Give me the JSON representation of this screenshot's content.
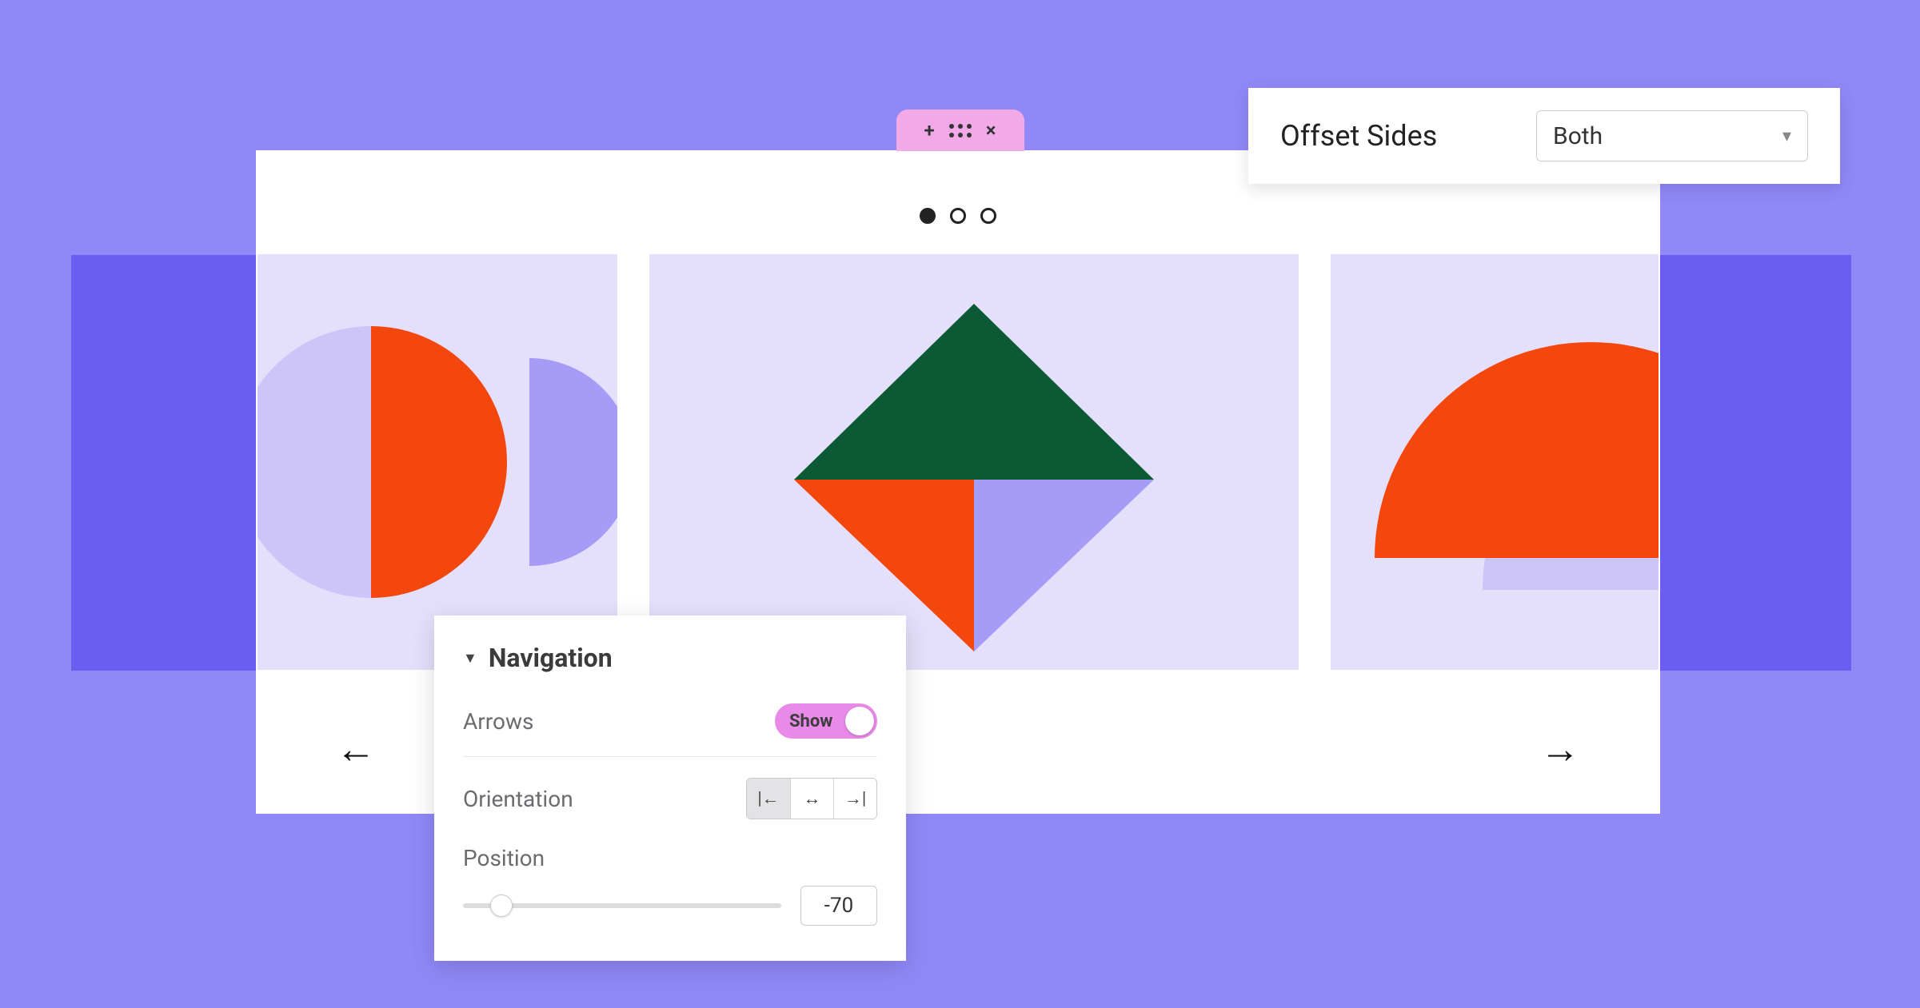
{
  "colors": {
    "bg": "#9088f7",
    "bgStripe": "#6b5cf2",
    "slide": "#e4e0fb",
    "orange": "#f3470e",
    "green": "#0b5a35",
    "lilac": "#a79bf8",
    "lightLilac": "#cdc5f8",
    "pinkTab": "#f2a9e8",
    "togglePink": "#e98ae9"
  },
  "editorTab": {
    "add": "+",
    "close": "×"
  },
  "carousel": {
    "activeIndex": 0,
    "slideCount": 3,
    "prevArrow": "←",
    "nextArrow": "→"
  },
  "offsetPanel": {
    "label": "Offset Sides",
    "selected": "Both"
  },
  "navPanel": {
    "title": "Navigation",
    "arrows": {
      "label": "Arrows",
      "toggleText": "Show",
      "value": true
    },
    "orientation": {
      "label": "Orientation",
      "options": [
        "left",
        "center",
        "right"
      ],
      "activeIndex": 0,
      "glyphs": [
        "|←",
        "↔",
        "→|"
      ]
    },
    "position": {
      "label": "Position",
      "value": "-70"
    }
  }
}
